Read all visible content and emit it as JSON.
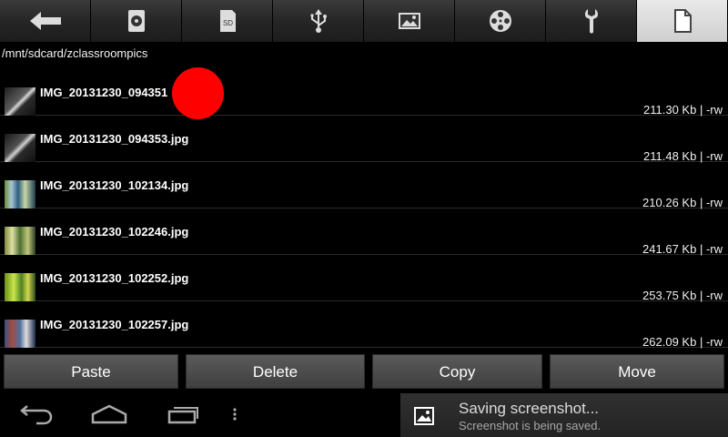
{
  "toolbar": {
    "buttons": [
      {
        "name": "back-arrow-icon"
      },
      {
        "name": "internal-storage-icon"
      },
      {
        "name": "sd-card-icon",
        "label": "SD"
      },
      {
        "name": "usb-icon"
      },
      {
        "name": "image-icon"
      },
      {
        "name": "video-reel-icon"
      },
      {
        "name": "wrench-icon"
      },
      {
        "name": "document-icon"
      }
    ]
  },
  "path": "/mnt/sdcard/zclassroompics",
  "files": [
    {
      "name": "IMG_20131230_094351",
      "size": "211.30 Kb",
      "perm": "-rw"
    },
    {
      "name": "IMG_20131230_094353.jpg",
      "size": "211.48 Kb",
      "perm": "-rw"
    },
    {
      "name": "IMG_20131230_102134.jpg",
      "size": "210.26 Kb",
      "perm": "-rw"
    },
    {
      "name": "IMG_20131230_102246.jpg",
      "size": "241.67 Kb",
      "perm": "-rw"
    },
    {
      "name": "IMG_20131230_102252.jpg",
      "size": "253.75 Kb",
      "perm": "-rw"
    },
    {
      "name": "IMG_20131230_102257.jpg",
      "size": "262.09 Kb",
      "perm": "-rw"
    }
  ],
  "actions": {
    "paste": "Paste",
    "delete": "Delete",
    "copy": "Copy",
    "move": "Move"
  },
  "notification": {
    "title": "Saving screenshot...",
    "text": "Screenshot is being saved."
  },
  "colors": {
    "highlight": "#ff0000",
    "active_tab": "#d6d6d6"
  }
}
